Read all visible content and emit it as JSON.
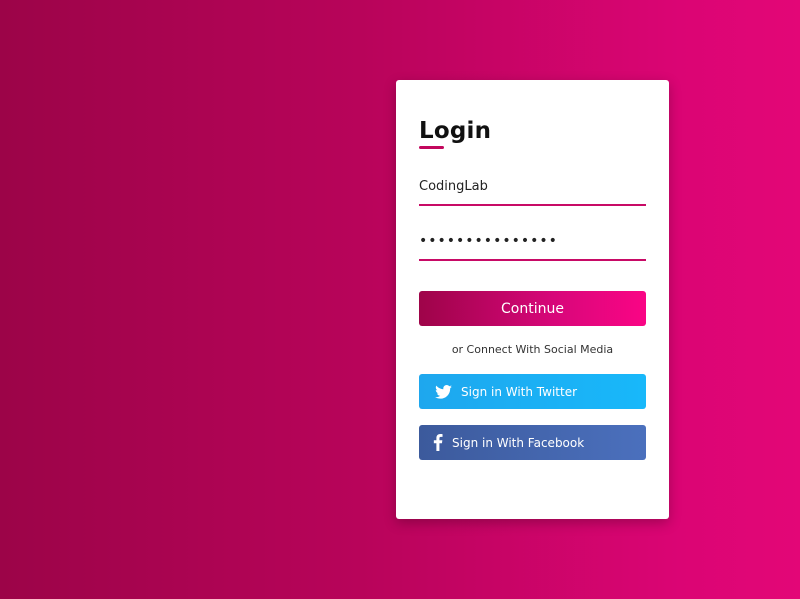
{
  "login": {
    "title": "Login",
    "username_value": "CodingLab",
    "password_value": "•••••••••••••••",
    "continue_label": "Continue",
    "social_text": "or Connect With Social Media",
    "twitter_label": "Sign in With Twitter",
    "facebook_label": "Sign in With Facebook"
  },
  "icons": {
    "twitter": "twitter-icon",
    "facebook": "facebook-icon"
  },
  "colors": {
    "accent": "#c80a66",
    "twitter": "#1da1f2",
    "facebook": "#3b5998",
    "card": "#ffffff"
  }
}
